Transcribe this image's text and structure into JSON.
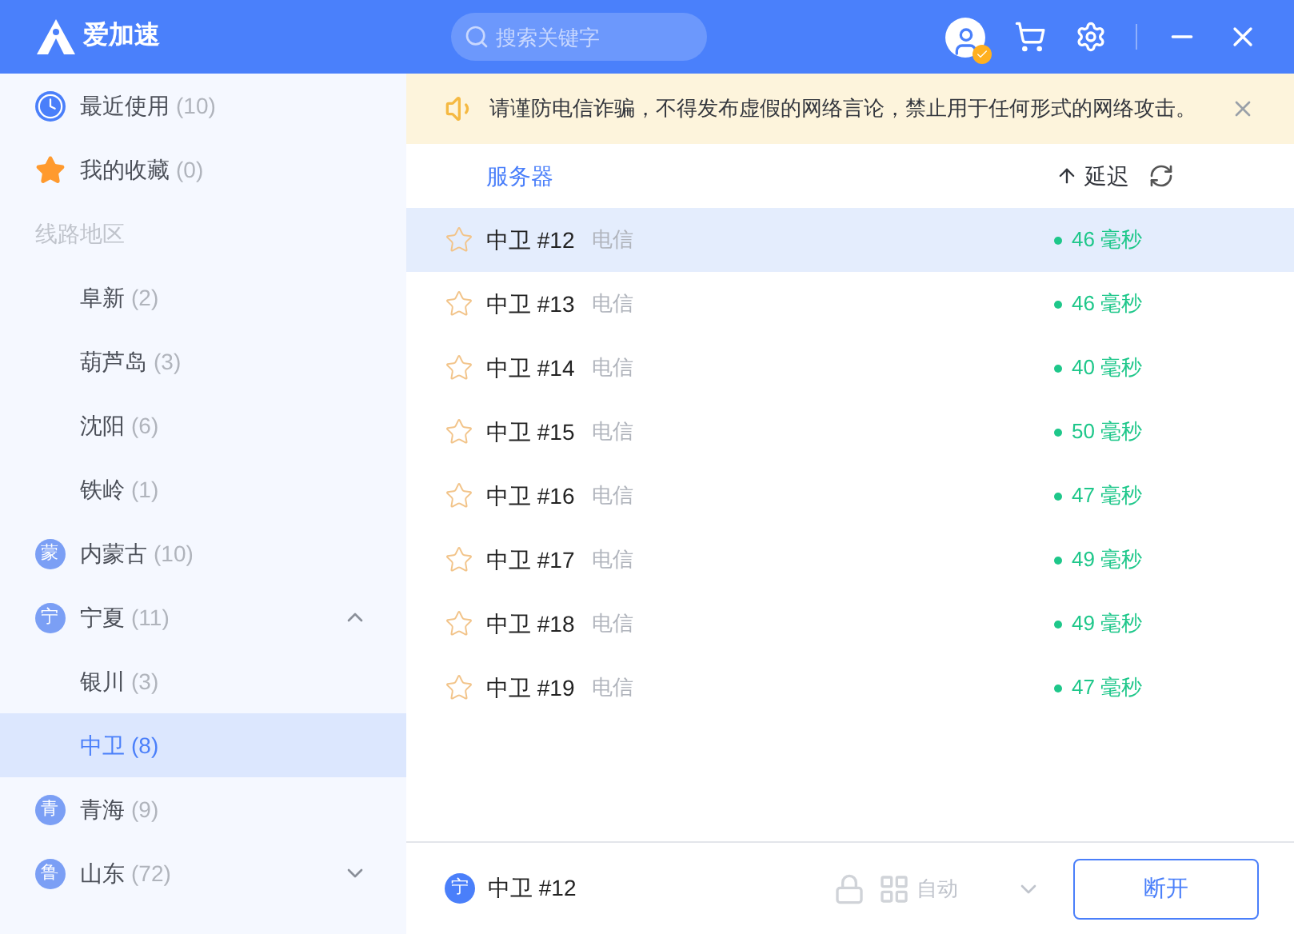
{
  "app": {
    "name": "爱加速"
  },
  "search": {
    "placeholder": "搜索关键字"
  },
  "sidebar": {
    "items": [
      {
        "kind": "recent",
        "label": "最近使用",
        "count": "(10)",
        "selected": false
      },
      {
        "kind": "favorite",
        "label": "我的收藏",
        "count": "(0)",
        "selected": false
      },
      {
        "kind": "header",
        "label": "线路地区"
      },
      {
        "kind": "city",
        "label": "阜新",
        "count": "(2)",
        "selected": false
      },
      {
        "kind": "city",
        "label": "葫芦岛",
        "count": "(3)",
        "selected": false
      },
      {
        "kind": "city",
        "label": "沈阳",
        "count": "(6)",
        "selected": false
      },
      {
        "kind": "city",
        "label": "铁岭",
        "count": "(1)",
        "selected": false
      },
      {
        "kind": "region",
        "badge": "蒙",
        "label": "内蒙古",
        "count": "(10)",
        "selected": false
      },
      {
        "kind": "region",
        "badge": "宁",
        "label": "宁夏",
        "count": "(11)",
        "selected": false,
        "expanded": true,
        "children": [
          {
            "kind": "city",
            "label": "银川",
            "count": "(3)",
            "selected": false
          },
          {
            "kind": "city",
            "label": "中卫",
            "count": "(8)",
            "selected": true
          }
        ]
      },
      {
        "kind": "region",
        "badge": "青",
        "label": "青海",
        "count": "(9)",
        "selected": false
      },
      {
        "kind": "region",
        "badge": "鲁",
        "label": "山东",
        "count": "(72)",
        "selected": false,
        "expanded": false
      }
    ]
  },
  "notice": {
    "text": "请谨防电信诈骗，不得发布虚假的网络言论，禁止用于任何形式的网络攻击。"
  },
  "table": {
    "columns": [
      "服务器",
      "延迟"
    ],
    "rows": [
      {
        "name": "中卫 #12",
        "isp": "电信",
        "latency": "46 毫秒",
        "selected": true
      },
      {
        "name": "中卫 #13",
        "isp": "电信",
        "latency": "46 毫秒",
        "selected": false
      },
      {
        "name": "中卫 #14",
        "isp": "电信",
        "latency": "40 毫秒",
        "selected": false
      },
      {
        "name": "中卫 #15",
        "isp": "电信",
        "latency": "50 毫秒",
        "selected": false
      },
      {
        "name": "中卫 #16",
        "isp": "电信",
        "latency": "47 毫秒",
        "selected": false
      },
      {
        "name": "中卫 #17",
        "isp": "电信",
        "latency": "49 毫秒",
        "selected": false
      },
      {
        "name": "中卫 #18",
        "isp": "电信",
        "latency": "49 毫秒",
        "selected": false
      },
      {
        "name": "中卫 #19",
        "isp": "电信",
        "latency": "47 毫秒",
        "selected": false
      }
    ]
  },
  "footer": {
    "badge": "宁",
    "server": "中卫 #12",
    "mode": "自动",
    "button": "断开"
  }
}
